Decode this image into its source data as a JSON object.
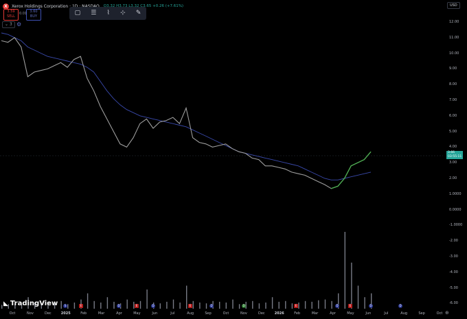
{
  "header": {
    "logo_letter": "X",
    "title": "Xerox Holdings Corporation · 1D · NASDAQ",
    "ohlc": "O3.32 H3.73 L3.32 C3.65 +0.26 (+7.61%)"
  },
  "trade": {
    "sell_price": "3.59",
    "sell_label": "SELL",
    "spread": "0.01",
    "buy_price": "3.60",
    "buy_label": "BUY"
  },
  "toolbar": {
    "tools": [
      "rectangle-icon",
      "fib-icon",
      "path-icon",
      "measure-icon",
      "pen-icon"
    ]
  },
  "indicator_collapse": "⌄ 3",
  "currency": "USD",
  "price_axis": [
    "12.00",
    "11.00",
    "10.00",
    "9.00",
    "8.00",
    "7.00",
    "6.00",
    "5.00",
    "4.00",
    "3.00",
    "2.00",
    "1.0000",
    "0.0000",
    "-1.0000",
    "-2.00",
    "-3.00",
    "-4.00",
    "-5.00",
    "-6.00"
  ],
  "price_tag": {
    "line1": "3.66",
    "line2": "03:55:11"
  },
  "time_axis": [
    "Oct",
    "Nov",
    "Dec",
    "2025",
    "Feb",
    "Mar",
    "Apr",
    "May",
    "Jun",
    "Jul",
    "Aug",
    "Sep",
    "Oct",
    "Nov",
    "Dec",
    "2026",
    "Feb",
    "Mar",
    "Apr",
    "May",
    "Jun",
    "Jul",
    "Aug",
    "Sep",
    "Oct"
  ],
  "brand": "TradingView",
  "chart_data": {
    "type": "line",
    "title": "",
    "series": [
      {
        "name": "",
        "values": [
          10.8,
          10.7,
          11.0,
          10.4,
          8.5,
          8.8,
          8.9,
          9.0,
          9.2,
          9.4,
          9.1,
          9.6,
          9.8,
          8.4,
          7.6,
          6.6,
          5.8,
          5.0,
          4.2,
          4.0,
          4.6,
          5.5,
          5.8,
          5.2,
          5.6,
          5.7,
          5.9,
          5.5,
          6.5,
          4.6,
          4.3,
          4.2,
          4.0,
          4.1,
          4.2,
          3.9,
          3.7,
          3.6,
          3.3,
          3.2,
          2.8,
          2.8,
          2.7,
          2.6,
          2.4,
          2.3,
          2.2,
          2.0,
          1.8,
          1.6,
          1.35,
          1.5,
          2.0,
          2.8,
          3.0,
          3.2,
          3.7
        ]
      },
      {
        "name": "",
        "values": [
          11.3,
          11.2,
          11.0,
          10.8,
          10.4,
          10.2,
          10.0,
          9.8,
          9.7,
          9.6,
          9.5,
          9.4,
          9.3,
          9.1,
          8.8,
          8.2,
          7.6,
          7.1,
          6.7,
          6.4,
          6.2,
          6.0,
          5.9,
          5.8,
          5.7,
          5.6,
          5.5,
          5.4,
          5.3,
          5.1,
          4.9,
          4.7,
          4.5,
          4.3,
          4.1,
          3.9,
          3.7,
          3.6,
          3.5,
          3.4,
          3.3,
          3.2,
          3.1,
          3.0,
          2.9,
          2.8,
          2.6,
          2.4,
          2.2,
          2.0,
          1.9,
          1.9,
          2.0,
          2.1,
          2.2,
          2.3,
          2.4
        ]
      }
    ],
    "ylim": [
      -6.5,
      13
    ],
    "volume": [
      0.05,
      0.06,
      0.07,
      0.05,
      0.15,
      0.08,
      0.06,
      0.09,
      0.07,
      0.1,
      0.06,
      0.08,
      0.12,
      0.2,
      0.1,
      0.08,
      0.15,
      0.09,
      0.07,
      0.12,
      0.09,
      0.1,
      0.25,
      0.08,
      0.07,
      0.09,
      0.12,
      0.08,
      0.3,
      0.1,
      0.08,
      0.07,
      0.1,
      0.09,
      0.08,
      0.12,
      0.06,
      0.09,
      0.1,
      0.07,
      0.08,
      0.15,
      0.09,
      0.1,
      0.07,
      0.08,
      0.1,
      0.09,
      0.11,
      0.12,
      0.1,
      0.2,
      1.0,
      0.6,
      0.3,
      0.15,
      0.2
    ],
    "grid": false
  }
}
